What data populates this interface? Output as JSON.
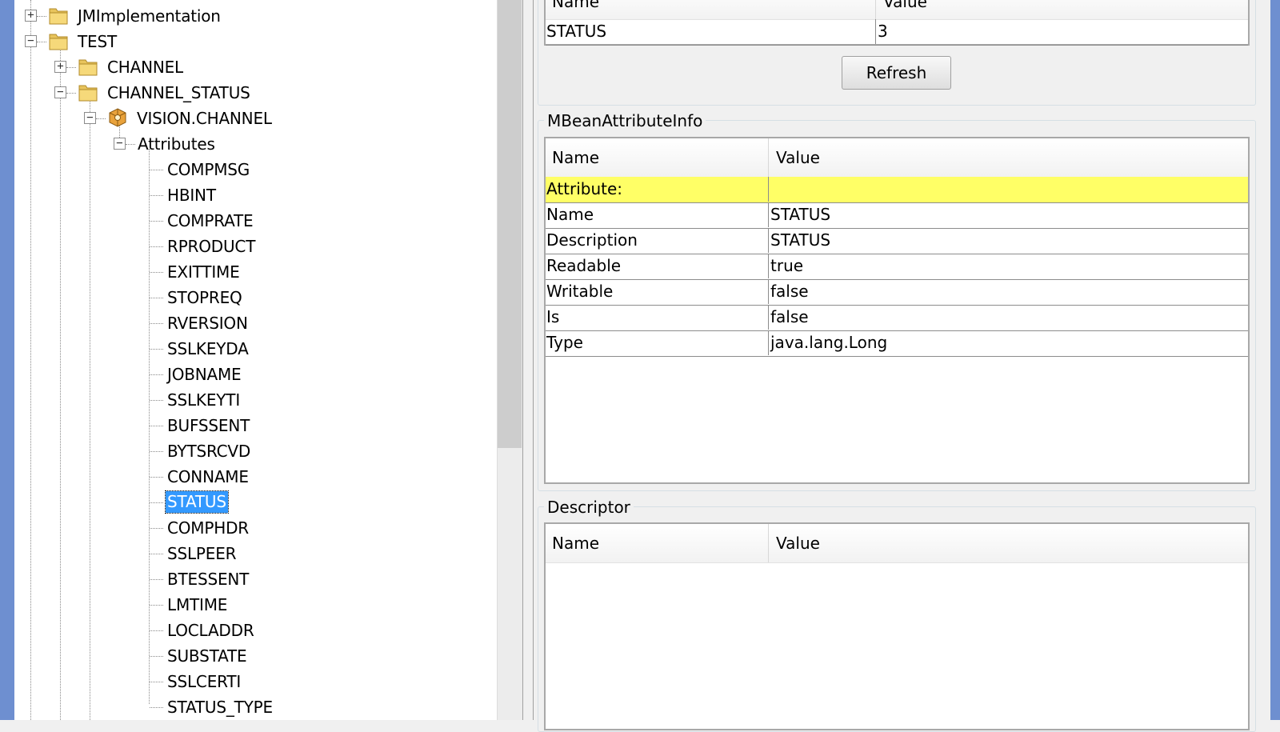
{
  "tree": {
    "nodes": [
      {
        "label": "JMImplementation",
        "expander": "+"
      },
      {
        "label": "TEST",
        "expander": "−"
      },
      {
        "label": "CHANNEL",
        "expander": "+"
      },
      {
        "label": "CHANNEL_STATUS",
        "expander": "−"
      },
      {
        "label": "VISION.CHANNEL",
        "expander": "−"
      },
      {
        "label": "Attributes",
        "expander": "−"
      }
    ],
    "attributes": [
      "COMPMSG",
      "HBINT",
      "COMPRATE",
      "RPRODUCT",
      "EXITTIME",
      "STOPREQ",
      "RVERSION",
      "SSLKEYDA",
      "JOBNAME",
      "SSLKEYTI",
      "BUFSSENT",
      "BYTSRCVD",
      "CONNAME",
      "STATUS",
      "COMPHDR",
      "SSLPEER",
      "BTESSENT",
      "LMTIME",
      "LOCLADDR",
      "SUBSTATE",
      "SSLCERTI",
      "STATUS_TYPE"
    ],
    "selected": "STATUS"
  },
  "value_panel": {
    "columns": [
      "Name",
      "Value"
    ],
    "row": {
      "name": "STATUS",
      "value": "3"
    },
    "refresh_label": "Refresh"
  },
  "attribute_info": {
    "title": "MBeanAttributeInfo",
    "columns": [
      "Name",
      "Value"
    ],
    "rows": [
      {
        "name": "Attribute:",
        "value": ""
      },
      {
        "name": "Name",
        "value": "STATUS"
      },
      {
        "name": "Description",
        "value": "STATUS"
      },
      {
        "name": "Readable",
        "value": "true"
      },
      {
        "name": "Writable",
        "value": "false"
      },
      {
        "name": "Is",
        "value": "false"
      },
      {
        "name": "Type",
        "value": "java.lang.Long"
      }
    ]
  },
  "descriptor": {
    "title": "Descriptor",
    "columns": [
      "Name",
      "Value"
    ]
  },
  "colors": {
    "selection": "#3399ff",
    "highlight_row": "#ffff66",
    "window_border": "#6e8fd0"
  }
}
